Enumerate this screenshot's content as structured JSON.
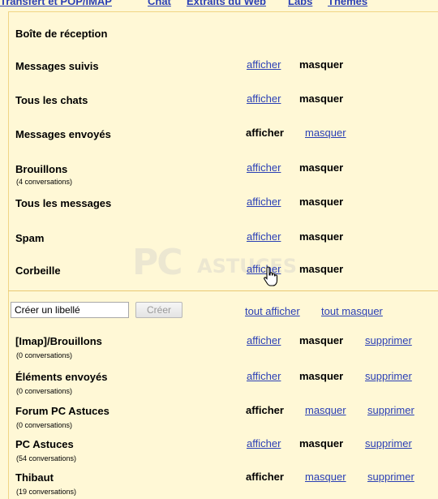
{
  "settings_tabs": [
    "Transfert et POP/IMAP",
    "Chat",
    "Extraits du Web",
    "Labs",
    "Thèmes"
  ],
  "system_labels": {
    "inbox": {
      "name": "Boîte de réception"
    },
    "items": [
      {
        "name": "Messages suivis",
        "count": "",
        "show": "afficher",
        "hide": "masquer",
        "state": "shown"
      },
      {
        "name": "Tous les chats",
        "count": "",
        "show": "afficher",
        "hide": "masquer",
        "state": "shown"
      },
      {
        "name": "Messages envoyés",
        "count": "",
        "show": "afficher",
        "hide": "masquer",
        "state": "hidden"
      },
      {
        "name": "Brouillons",
        "count": "(4 conversations)",
        "show": "afficher",
        "hide": "masquer",
        "state": "shown"
      },
      {
        "name": "Tous les messages",
        "count": "",
        "show": "afficher",
        "hide": "masquer",
        "state": "shown"
      },
      {
        "name": "Spam",
        "count": "",
        "show": "afficher",
        "hide": "masquer",
        "state": "shown"
      },
      {
        "name": "Corbeille",
        "count": "",
        "show": "afficher",
        "hide": "masquer",
        "state": "shown"
      }
    ]
  },
  "create_label": {
    "input_value": "Créer un libellé",
    "button_label": "Créer",
    "show_all": "tout afficher",
    "hide_all": "tout masquer"
  },
  "user_labels": [
    {
      "name": "[Imap]/Brouillons",
      "count": "(0 conversations)",
      "show": "afficher",
      "hide": "masquer",
      "delete": "supprimer",
      "state": "shown"
    },
    {
      "name": "Éléments envoyés",
      "count": "(0 conversations)",
      "show": "afficher",
      "hide": "masquer",
      "delete": "supprimer",
      "state": "shown"
    },
    {
      "name": "Forum PC Astuces",
      "count": "(0 conversations)",
      "show": "afficher",
      "hide": "masquer",
      "delete": "supprimer",
      "state": "hidden"
    },
    {
      "name": "PC Astuces",
      "count": "(54 conversations)",
      "show": "afficher",
      "hide": "masquer",
      "delete": "supprimer",
      "state": "shown"
    },
    {
      "name": "Thibaut",
      "count": "(19 conversations)",
      "show": "afficher",
      "hide": "masquer",
      "delete": "supprimer",
      "state": "hidden"
    }
  ],
  "watermark": {
    "big": "PC",
    "small": "ASTUCES"
  },
  "colors": {
    "background": "#fff8d6",
    "link": "#2a3fb5",
    "divider": "#e8c872"
  },
  "icons": {
    "cursor": "hand-pointer-icon"
  }
}
